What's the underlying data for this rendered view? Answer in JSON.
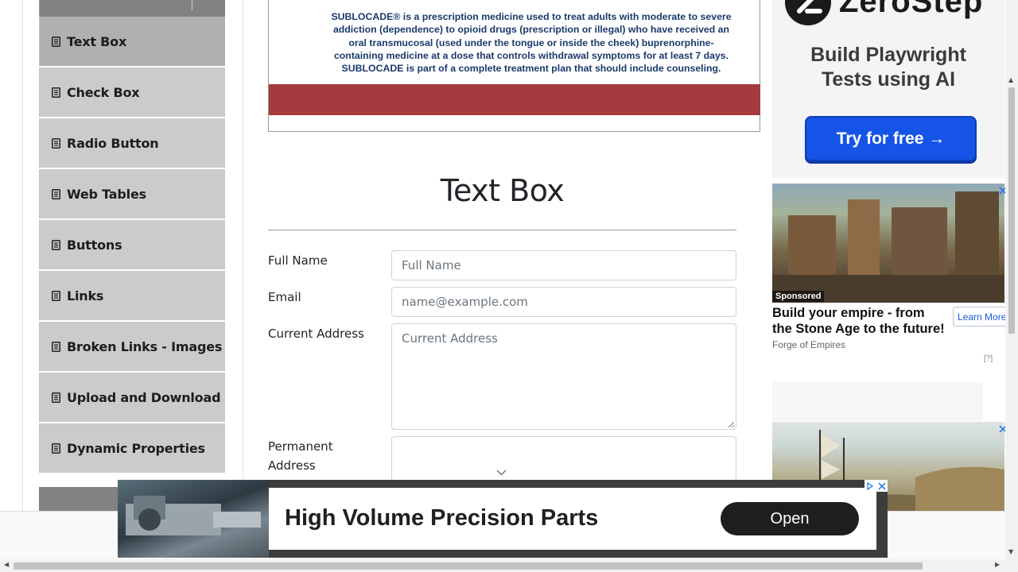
{
  "sidebar": {
    "items": [
      {
        "label": "Text Box",
        "active": true
      },
      {
        "label": "Check Box",
        "active": false
      },
      {
        "label": "Radio Button",
        "active": false
      },
      {
        "label": "Web Tables",
        "active": false
      },
      {
        "label": "Buttons",
        "active": false
      },
      {
        "label": "Links",
        "active": false
      },
      {
        "label": "Broken Links - Images",
        "active": false
      },
      {
        "label": "Upload and Download",
        "active": false
      },
      {
        "label": "Dynamic Properties",
        "active": false
      }
    ]
  },
  "top_ad": {
    "text": "SUBLOCADE® is a prescription medicine used to treat adults with moderate to severe addiction (dependence) to opioid drugs (prescription or illegal) who have received an oral transmucosal (used under the tongue or inside the cheek) buprenorphine-containing medicine at a dose that controls withdrawal symptoms for at least 7 days. SUBLOCADE is part of a complete treatment plan that should include counseling.",
    "bar_color": "#a43a3e"
  },
  "main": {
    "title": "Text Box",
    "form": {
      "full_name": {
        "label": "Full Name",
        "placeholder": "Full Name",
        "value": ""
      },
      "email": {
        "label": "Email",
        "placeholder": "name@example.com",
        "value": ""
      },
      "current_address": {
        "label": "Current Address",
        "placeholder": "Current Address",
        "value": ""
      },
      "permanent_address": {
        "label": "Permanent Address",
        "value": ""
      }
    }
  },
  "right_ads": {
    "zerostep": {
      "brand": "ZeroStep",
      "headline_line1": "Build Playwright",
      "headline_line2": "Tests using AI",
      "cta": "Try for free →",
      "cta_color": "#1554e6"
    },
    "foe": {
      "badge": "Sponsored",
      "title": "Build your empire - from the Stone Age to the future!",
      "source": "Forge of Empires",
      "cta": "Learn More",
      "help": "[?]"
    }
  },
  "bottom_ad": {
    "title": "High Volume Precision Parts",
    "cta": "Open"
  },
  "icons": {
    "sidebar_item": "document-icon",
    "close": "close-icon",
    "adchoices": "adchoices-icon",
    "chevron": "chevron-down-icon"
  }
}
